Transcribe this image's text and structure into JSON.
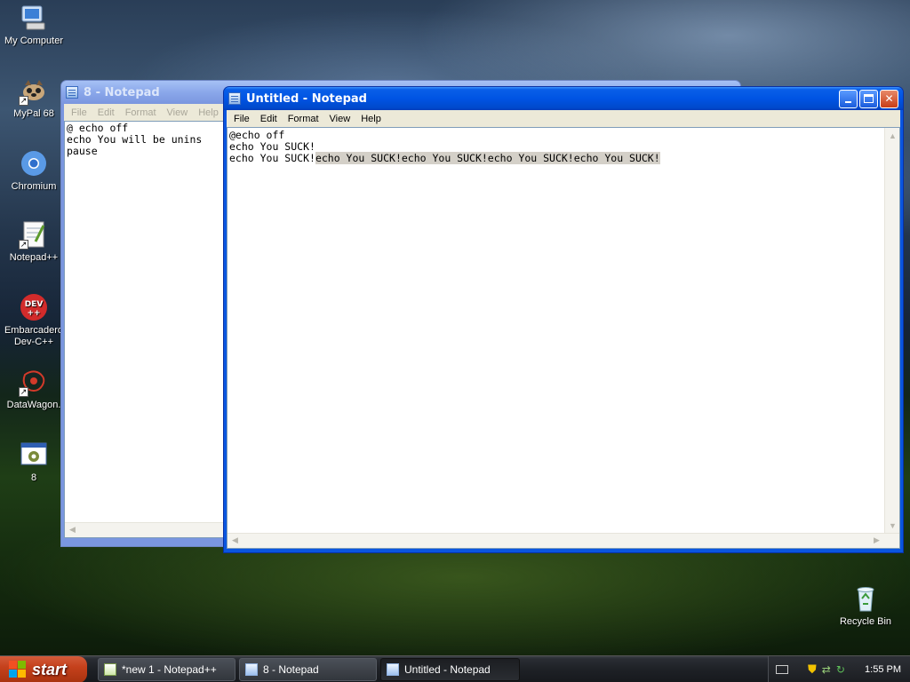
{
  "desktop": {
    "icons": [
      {
        "label": "My Computer"
      },
      {
        "label": "MyPal 68"
      },
      {
        "label": "Chromium"
      },
      {
        "label": "Notepad++"
      },
      {
        "label": "Embarcadero Dev-C++"
      },
      {
        "label": "DataWagon."
      },
      {
        "label": "8"
      },
      {
        "label": "Recycle Bin"
      }
    ]
  },
  "back_window": {
    "title": "8 - Notepad",
    "menu": [
      "File",
      "Edit",
      "Format",
      "View",
      "Help"
    ],
    "lines": [
      "@ echo off",
      "echo You will be unins",
      "pause"
    ]
  },
  "front_window": {
    "title": "Untitled - Notepad",
    "menu": [
      "File",
      "Edit",
      "Format",
      "View",
      "Help"
    ],
    "line1": "@echo off",
    "line2": "echo You SUCK!",
    "line3_plain": "echo You SUCK!",
    "line3_selected": "echo You SUCK!echo You SUCK!echo You SUCK!echo You SUCK!"
  },
  "taskbar": {
    "start_label": "start",
    "buttons": [
      "*new 1 - Notepad++",
      "8 - Notepad",
      "Untitled - Notepad"
    ],
    "clock": "1:55 PM"
  }
}
